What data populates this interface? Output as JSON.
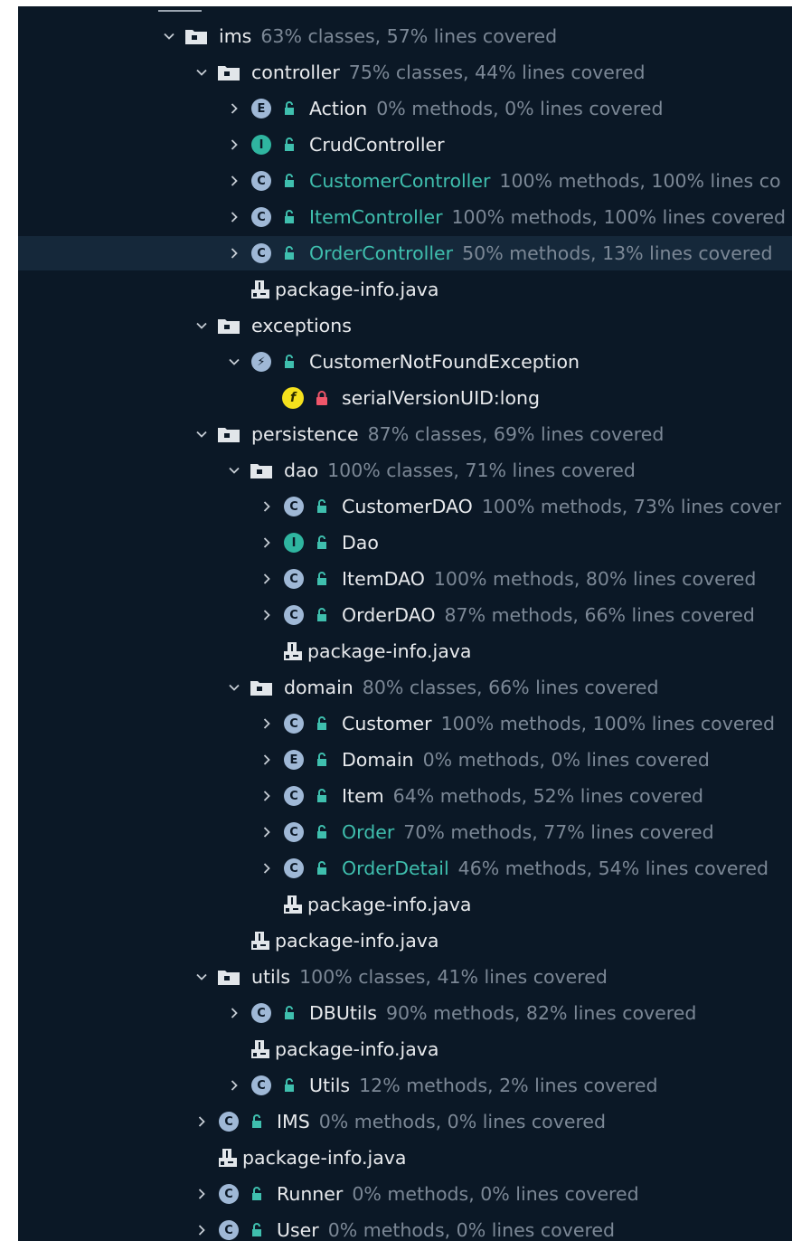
{
  "tree": [
    {
      "depth": 0,
      "expand": "expanded",
      "icon": "folder-icon",
      "label": "ims",
      "stats": "63% classes, 57% lines covered"
    },
    {
      "depth": 1,
      "expand": "expanded",
      "icon": "folder-icon",
      "label": "controller",
      "stats": "75% classes, 44% lines covered"
    },
    {
      "depth": 2,
      "expand": "collapsed",
      "icon": "enum-icon",
      "badge": "E",
      "vis": "public",
      "label": "Action",
      "stats": "0% methods, 0% lines covered"
    },
    {
      "depth": 2,
      "expand": "collapsed",
      "icon": "interface-icon",
      "badge": "I",
      "vis": "public",
      "label": "CrudController",
      "stats": ""
    },
    {
      "depth": 2,
      "expand": "collapsed",
      "icon": "class-icon",
      "badge": "C",
      "vis": "public",
      "label": "CustomerController",
      "stats": "100% methods, 100% lines co",
      "teal": true
    },
    {
      "depth": 2,
      "expand": "collapsed",
      "icon": "class-icon",
      "badge": "C",
      "vis": "public",
      "label": "ItemController",
      "stats": "100% methods, 100% lines covered",
      "teal": true
    },
    {
      "depth": 2,
      "expand": "collapsed",
      "icon": "class-icon",
      "badge": "C",
      "vis": "public",
      "label": "OrderController",
      "stats": "50% methods, 13% lines covered",
      "teal": true,
      "selected": true
    },
    {
      "depth": 2,
      "expand": "none",
      "icon": "java-file-icon",
      "label": "package-info.java",
      "stats": ""
    },
    {
      "depth": 1,
      "expand": "expanded",
      "icon": "folder-icon",
      "label": "exceptions",
      "stats": ""
    },
    {
      "depth": 2,
      "expand": "expanded",
      "icon": "exception-class-icon",
      "badge": "⚡",
      "vis": "public",
      "label": "CustomerNotFoundException",
      "stats": ""
    },
    {
      "depth": 3,
      "expand": "none",
      "icon": "field-icon",
      "badge": "f",
      "vis": "private",
      "label": "serialVersionUID:long",
      "stats": ""
    },
    {
      "depth": 1,
      "expand": "expanded",
      "icon": "folder-icon",
      "label": "persistence",
      "stats": "87% classes, 69% lines covered"
    },
    {
      "depth": 2,
      "expand": "expanded",
      "icon": "folder-icon",
      "label": "dao",
      "stats": "100% classes, 71% lines covered"
    },
    {
      "depth": 3,
      "expand": "collapsed",
      "icon": "class-icon",
      "badge": "C",
      "vis": "public",
      "label": "CustomerDAO",
      "stats": "100% methods, 73% lines cover"
    },
    {
      "depth": 3,
      "expand": "collapsed",
      "icon": "interface-icon",
      "badge": "I",
      "vis": "public",
      "label": "Dao",
      "stats": ""
    },
    {
      "depth": 3,
      "expand": "collapsed",
      "icon": "class-icon",
      "badge": "C",
      "vis": "public",
      "label": "ItemDAO",
      "stats": "100% methods, 80% lines covered"
    },
    {
      "depth": 3,
      "expand": "collapsed",
      "icon": "class-icon",
      "badge": "C",
      "vis": "public",
      "label": "OrderDAO",
      "stats": "87% methods, 66% lines covered"
    },
    {
      "depth": 3,
      "expand": "none",
      "icon": "java-file-icon",
      "label": "package-info.java",
      "stats": ""
    },
    {
      "depth": 2,
      "expand": "expanded",
      "icon": "folder-icon",
      "label": "domain",
      "stats": "80% classes, 66% lines covered"
    },
    {
      "depth": 3,
      "expand": "collapsed",
      "icon": "class-icon",
      "badge": "C",
      "vis": "public",
      "label": "Customer",
      "stats": "100% methods, 100% lines covered"
    },
    {
      "depth": 3,
      "expand": "collapsed",
      "icon": "enum-icon",
      "badge": "E",
      "vis": "public",
      "label": "Domain",
      "stats": "0% methods, 0% lines covered"
    },
    {
      "depth": 3,
      "expand": "collapsed",
      "icon": "class-icon",
      "badge": "C",
      "vis": "public",
      "label": "Item",
      "stats": "64% methods, 52% lines covered"
    },
    {
      "depth": 3,
      "expand": "collapsed",
      "icon": "class-icon",
      "badge": "C",
      "vis": "public",
      "label": "Order",
      "stats": "70% methods, 77% lines covered",
      "teal": true
    },
    {
      "depth": 3,
      "expand": "collapsed",
      "icon": "class-icon",
      "badge": "C",
      "vis": "public",
      "label": "OrderDetail",
      "stats": "46% methods, 54% lines covered",
      "teal": true
    },
    {
      "depth": 3,
      "expand": "none",
      "icon": "java-file-icon",
      "label": "package-info.java",
      "stats": ""
    },
    {
      "depth": 2,
      "expand": "none",
      "icon": "java-file-icon",
      "label": "package-info.java",
      "stats": ""
    },
    {
      "depth": 1,
      "expand": "expanded",
      "icon": "folder-icon",
      "label": "utils",
      "stats": "100% classes, 41% lines covered"
    },
    {
      "depth": 2,
      "expand": "collapsed",
      "icon": "class-icon",
      "badge": "C",
      "vis": "public",
      "label": "DBUtils",
      "stats": "90% methods, 82% lines covered"
    },
    {
      "depth": 2,
      "expand": "none",
      "icon": "java-file-icon",
      "label": "package-info.java",
      "stats": ""
    },
    {
      "depth": 2,
      "expand": "collapsed",
      "icon": "class-icon",
      "badge": "C",
      "vis": "public",
      "label": "Utils",
      "stats": "12% methods, 2% lines covered"
    },
    {
      "depth": 1,
      "expand": "collapsed",
      "icon": "class-icon",
      "badge": "C",
      "vis": "public",
      "label": "IMS",
      "stats": "0% methods, 0% lines covered"
    },
    {
      "depth": 1,
      "expand": "none",
      "icon": "java-file-icon",
      "label": "package-info.java",
      "stats": ""
    },
    {
      "depth": 1,
      "expand": "collapsed",
      "icon": "runnable-class-icon",
      "badge": "C",
      "vis": "public",
      "label": "Runner",
      "stats": "0% methods, 0% lines covered"
    },
    {
      "depth": 1,
      "expand": "collapsed",
      "icon": "class-icon",
      "badge": "C",
      "vis": "public",
      "label": "User",
      "stats": "0% methods, 0% lines covered"
    }
  ]
}
